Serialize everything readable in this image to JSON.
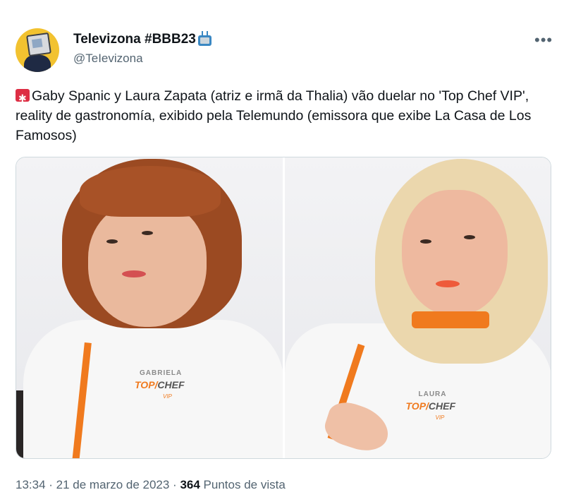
{
  "author": {
    "display_name": "Televizona #BBB23",
    "handle": "@TeIevizona",
    "avatar_icon": "tv-headed-man-avatar",
    "badge_icon": "television-emoji"
  },
  "tweet": {
    "lead_icon": "siren-emoji",
    "text": "Gaby Spanic y Laura Zapata (atriz e irmã da Thalia) vão duelar no 'Top Chef VIP', reality de gastronomía, exibido pela Telemundo (emissora que exibe La Casa de Los Famosos)"
  },
  "media": {
    "left": {
      "name_tag": "GABRIELA",
      "logo_top": "TOP",
      "logo_chef": "CHEF",
      "logo_vip": "VIP"
    },
    "right": {
      "name_tag": "LAURA",
      "logo_top": "TOP",
      "logo_chef": "CHEF",
      "logo_vip": "VIP"
    }
  },
  "meta": {
    "time": "13:34",
    "separator": " · ",
    "date": "21 de marzo de 2023",
    "views_count": "364",
    "views_label": "Puntos de vista"
  },
  "menu_icon": "more-horizontal-icon",
  "colors": {
    "accent_orange": "#f07a1e",
    "text_primary": "#0f1419",
    "text_secondary": "#536471"
  }
}
